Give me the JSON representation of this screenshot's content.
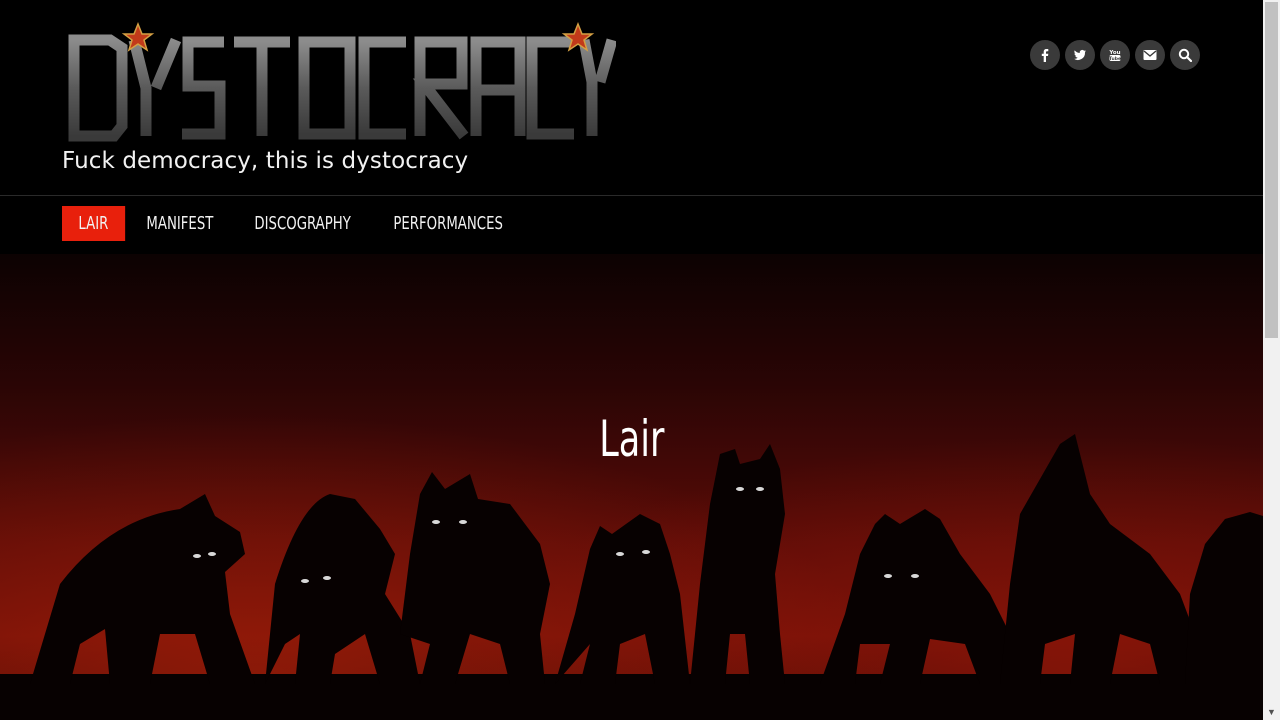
{
  "site": {
    "logo_text": "DYSTOCRACY",
    "tagline": "Fuck democracy, this is dystocracy"
  },
  "social": [
    {
      "icon": "facebook-icon"
    },
    {
      "icon": "twitter-icon"
    },
    {
      "icon": "youtube-icon",
      "label": "You Tube"
    },
    {
      "icon": "email-icon"
    },
    {
      "icon": "search-icon"
    }
  ],
  "nav": {
    "items": [
      {
        "label": "LAIR",
        "active": true
      },
      {
        "label": "MANIFEST"
      },
      {
        "label": "DISCOGRAPHY"
      },
      {
        "label": "PERFORMANCES"
      }
    ]
  },
  "hero": {
    "title": "Lair"
  },
  "colors": {
    "accent": "#e8200c",
    "background": "#000000",
    "hero_red": "#6a0d07"
  }
}
